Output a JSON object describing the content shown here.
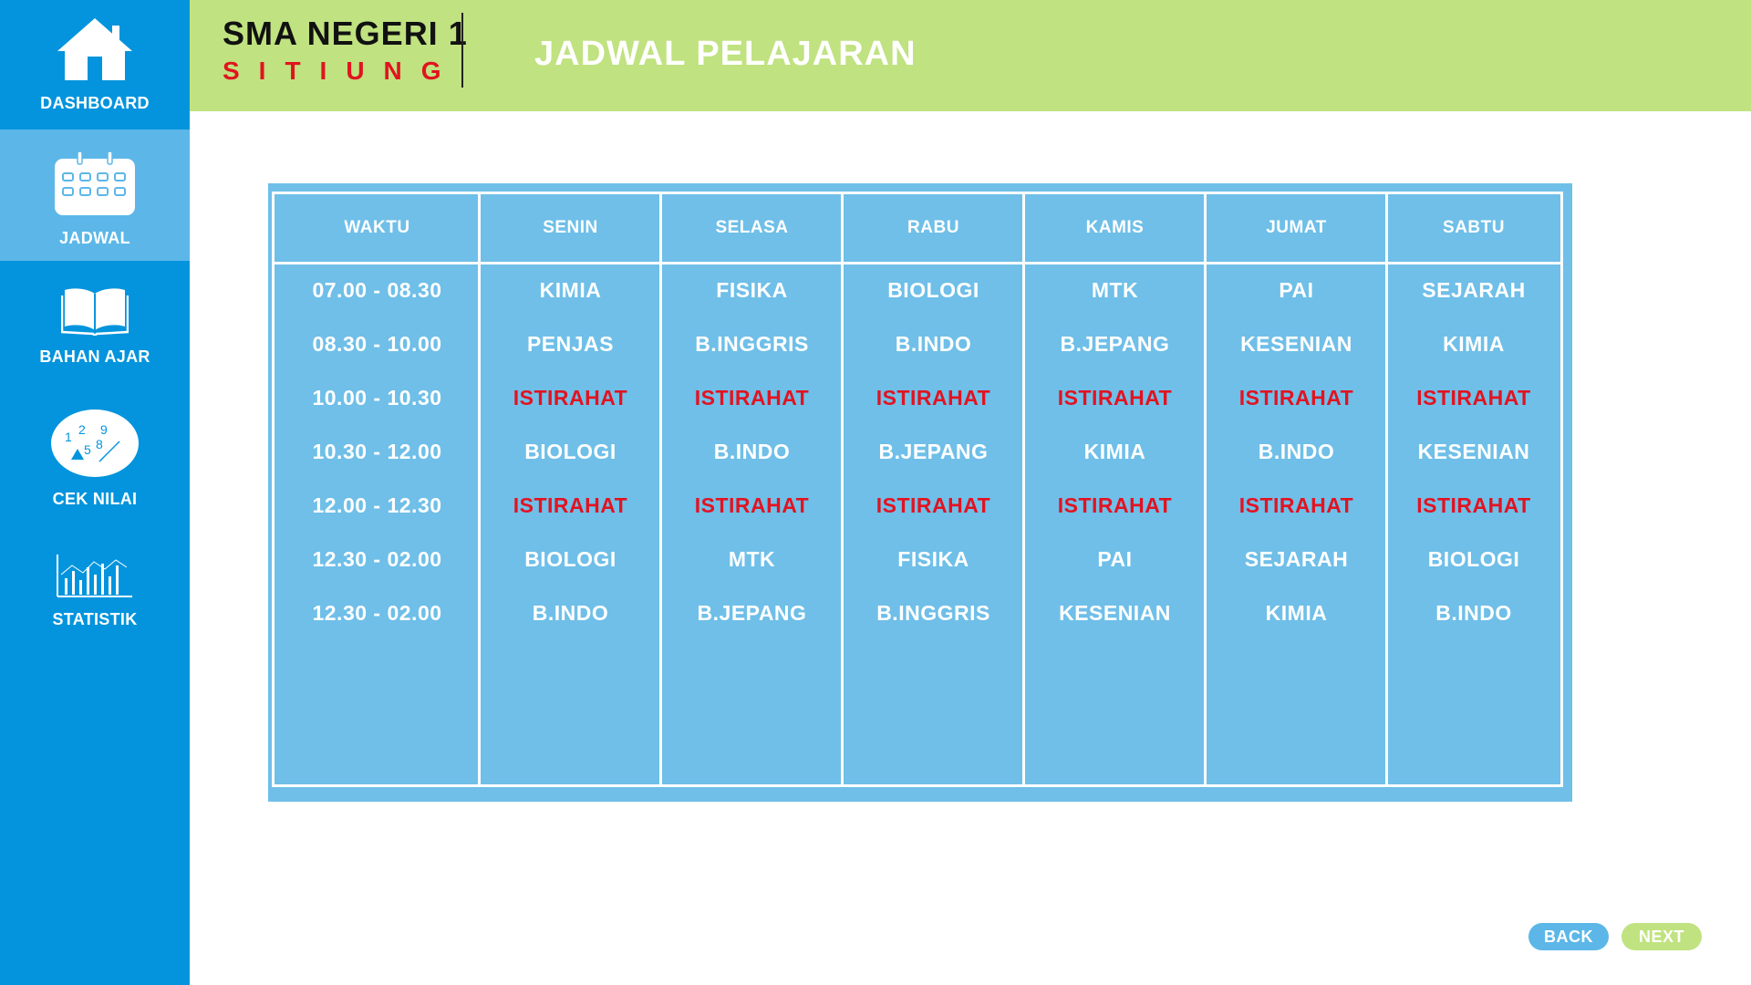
{
  "sidebar": {
    "items": [
      {
        "label": "DASHBOARD",
        "icon": "home-icon"
      },
      {
        "label": "JADWAL",
        "icon": "calendar-icon",
        "active": true
      },
      {
        "label": "BAHAN AJAR",
        "icon": "book-icon"
      },
      {
        "label": "CEK NILAI",
        "icon": "numbers-icon"
      },
      {
        "label": "STATISTIK",
        "icon": "bar-chart-icon"
      }
    ]
  },
  "header": {
    "school_name": "SMA NEGERI 1",
    "school_city": "SITIUNG",
    "title": "JADWAL PELAJARAN"
  },
  "schedule": {
    "columns": [
      "WAKTU",
      "SENIN",
      "SELASA",
      "RABU",
      "KAMIS",
      "JUMAT",
      "SABTU"
    ],
    "times": [
      "07.00 - 08.30",
      "08.30 - 10.00",
      "10.00 - 10.30",
      "10.30 - 12.00",
      "12.00 - 12.30",
      "12.30 - 02.00",
      "12.30 - 02.00"
    ],
    "days": [
      [
        "KIMIA",
        "PENJAS",
        "ISTIRAHAT",
        "BIOLOGI",
        "ISTIRAHAT",
        "BIOLOGI",
        "B.INDO"
      ],
      [
        "FISIKA",
        "B.INGGRIS",
        "ISTIRAHAT",
        "B.INDO",
        "ISTIRAHAT",
        "MTK",
        "B.JEPANG"
      ],
      [
        "BIOLOGI",
        "B.INDO",
        "ISTIRAHAT",
        "B.JEPANG",
        "ISTIRAHAT",
        "FISIKA",
        "B.INGGRIS"
      ],
      [
        "MTK",
        "B.JEPANG",
        "ISTIRAHAT",
        "KIMIA",
        "ISTIRAHAT",
        "PAI",
        "KESENIAN"
      ],
      [
        "PAI",
        "KESENIAN",
        "ISTIRAHAT",
        "B.INDO",
        "ISTIRAHAT",
        "SEJARAH",
        "KIMIA"
      ],
      [
        "SEJARAH",
        "KIMIA",
        "ISTIRAHAT",
        "KESENIAN",
        "ISTIRAHAT",
        "BIOLOGI",
        "B.INDO"
      ]
    ],
    "break_label": "ISTIRAHAT"
  },
  "buttons": {
    "back": "BACK",
    "next": "NEXT"
  },
  "colors": {
    "sidebar": "#0394dd",
    "sidebar_active": "#5cb7e8",
    "header": "#c0e280",
    "table": "#6fbfe8",
    "break_text": "#e21321",
    "city_text": "#e0141f"
  }
}
